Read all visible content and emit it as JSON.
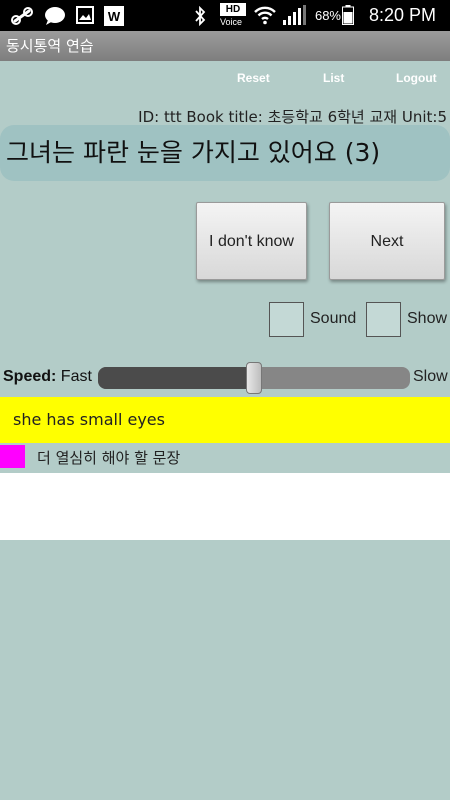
{
  "status_bar": {
    "hd_label": "HD",
    "voice_label": "Voice",
    "battery_percent": "68%",
    "time": "8:20 PM",
    "icons": [
      "link-icon",
      "chat-bubble-icon",
      "image-icon",
      "w-app-icon",
      "bluetooth-icon",
      "wifi-icon",
      "signal-icon",
      "battery-icon"
    ]
  },
  "app": {
    "title": "동시통역 연습"
  },
  "top_links": {
    "reset": "Reset",
    "list": "List",
    "logout": "Logout"
  },
  "info_line": "ID: ttt  Book title: 초등학교 6학년 교재  Unit:5",
  "sentence": "그녀는 파란 눈을 가지고 있어요 (3)",
  "buttons": {
    "dont_know": "I don't know",
    "next": "Next"
  },
  "options": {
    "sound_label": "Sound",
    "show_label": "Show",
    "sound_checked": false,
    "show_checked": false
  },
  "speed": {
    "label": "Speed:",
    "fast_label": "Fast",
    "slow_label": "Slow",
    "value": 0.5
  },
  "answer": "she has small eyes",
  "flag": {
    "label": "더 열심히 해야 할 문장",
    "color": "#ff00ff"
  },
  "colors": {
    "background": "#b3ccc8",
    "sentence_bg": "#9fc2c2",
    "answer_bg": "#ffff00"
  }
}
